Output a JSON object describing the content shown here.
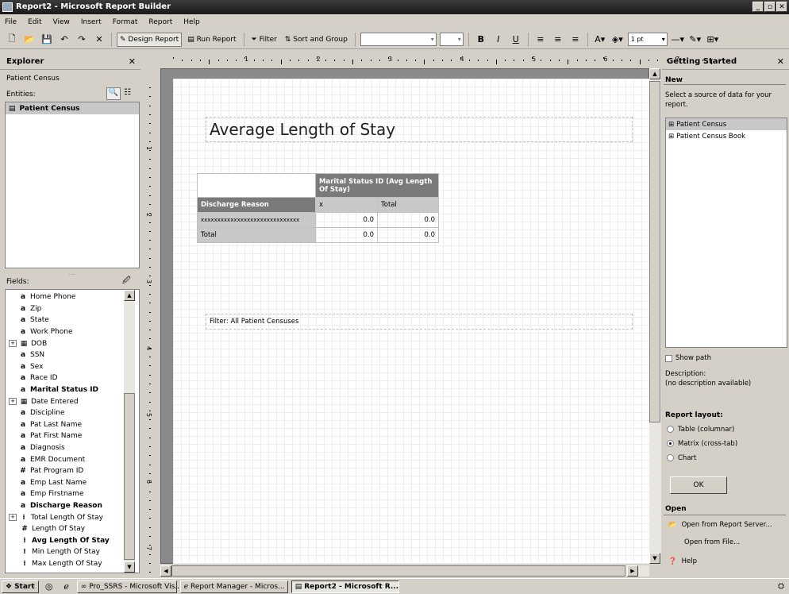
{
  "window": {
    "title": "Report2 - Microsoft Report Builder"
  },
  "menu": [
    "File",
    "Edit",
    "View",
    "Insert",
    "Format",
    "Report",
    "Help"
  ],
  "toolbar": {
    "design_report": "Design Report",
    "run_report": "Run Report",
    "filter": "Filter",
    "sort_group": "Sort and Group",
    "size_value": "1 pt"
  },
  "explorer": {
    "title": "Explorer",
    "model": "Patient Census",
    "entities_label": "Entities:",
    "entity": "Patient Census",
    "fields_label": "Fields:",
    "fields": [
      {
        "icon": "a",
        "label": "Home Phone",
        "bold": false
      },
      {
        "icon": "a",
        "label": "Zip",
        "bold": false
      },
      {
        "icon": "a",
        "label": "State",
        "bold": false
      },
      {
        "icon": "a",
        "label": "Work Phone",
        "bold": false
      },
      {
        "icon": "table",
        "label": "DOB",
        "bold": false,
        "expand": true
      },
      {
        "icon": "a",
        "label": "SSN",
        "bold": false
      },
      {
        "icon": "a",
        "label": "Sex",
        "bold": false
      },
      {
        "icon": "a",
        "label": "Race ID",
        "bold": false
      },
      {
        "icon": "a",
        "label": "Marital Status ID",
        "bold": true
      },
      {
        "icon": "table",
        "label": "Date Entered",
        "bold": false,
        "expand": true
      },
      {
        "icon": "a",
        "label": "Discipline",
        "bold": false
      },
      {
        "icon": "a",
        "label": "Pat Last Name",
        "bold": false
      },
      {
        "icon": "a",
        "label": "Pat First Name",
        "bold": false
      },
      {
        "icon": "a",
        "label": "Diagnosis",
        "bold": false
      },
      {
        "icon": "a",
        "label": "EMR Document",
        "bold": false
      },
      {
        "icon": "#",
        "label": "Pat Program ID",
        "bold": false
      },
      {
        "icon": "a",
        "label": "Emp Last Name",
        "bold": false
      },
      {
        "icon": "a",
        "label": "Emp Firstname",
        "bold": false
      },
      {
        "icon": "a",
        "label": "Discharge Reason",
        "bold": true
      },
      {
        "icon": "agg",
        "label": "Total Length Of Stay",
        "bold": false,
        "expand": true
      },
      {
        "icon": "#",
        "label": "Length Of Stay",
        "bold": false,
        "indent": true
      },
      {
        "icon": "agg",
        "label": "Avg Length Of Stay",
        "bold": true,
        "indent": true
      },
      {
        "icon": "agg",
        "label": "Min Length Of Stay",
        "bold": false,
        "indent": true
      },
      {
        "icon": "agg",
        "label": "Max Length Of Stay",
        "bold": false,
        "indent": true
      }
    ]
  },
  "ruler": {
    "top": [
      "1",
      "2",
      "3",
      "4",
      "5",
      "6",
      "7"
    ],
    "left": [
      "1",
      "2",
      "3",
      "4",
      "5",
      "6",
      "7"
    ]
  },
  "report": {
    "title": "Average Length of Stay",
    "matrix": {
      "col_header": "Marital Status ID (Avg Length Of Stay)",
      "row_header": "Discharge Reason",
      "col_x": "x",
      "col_total": "Total",
      "row_value": "xxxxxxxxxxxxxxxxxxxxxxxxxxxxxx",
      "cell1": "0.0",
      "cell2": "0.0",
      "total_label": "Total",
      "cell3": "0.0",
      "cell4": "0.0"
    },
    "filter": "Filter: All Patient Censuses"
  },
  "getting_started": {
    "title": "Getting Started",
    "new_heading": "New",
    "select_text": "Select a source of data for your report.",
    "sources": [
      "Patient Census",
      "Patient Census Book"
    ],
    "show_path": "Show path",
    "desc_label": "Description:",
    "desc_value": "(no description available)",
    "layout_heading": "Report layout:",
    "layouts": [
      "Table (columnar)",
      "Matrix (cross-tab)",
      "Chart"
    ],
    "ok": "OK",
    "open_heading": "Open",
    "open_server": "Open from Report Server...",
    "open_file": "Open from File...",
    "help": "Help"
  },
  "taskbar": {
    "start": "Start",
    "items": [
      "Pro_SSRS - Microsoft Vis...",
      "Report Manager - Micros...",
      "Report2 - Microsoft R..."
    ]
  }
}
